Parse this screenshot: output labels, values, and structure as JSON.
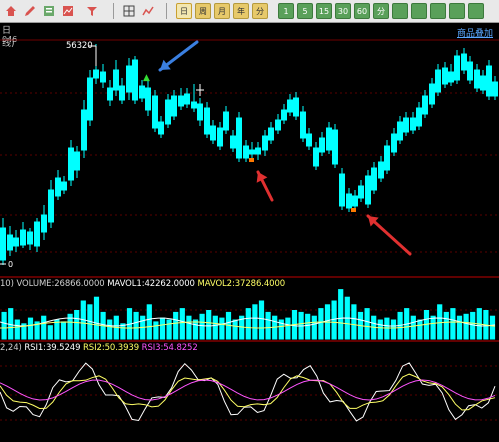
{
  "toolbar": {
    "icons": [
      "house-icon",
      "pen-icon",
      "notebook-icon",
      "chart-icon",
      "filter-icon",
      "grid-icon",
      "line-chart-icon"
    ],
    "period_buttons": [
      "日",
      "周",
      "月",
      "年",
      "1",
      "5",
      "15",
      "30",
      "60",
      "分",
      "分"
    ]
  },
  "info": {
    "left": "日线)",
    "left_prefix": "046",
    "right": "商品叠加"
  },
  "main_chart": {
    "high_label": "56320",
    "low_label": "0",
    "colors": {
      "up": "#ff3a3a",
      "down": "#00ffff",
      "grid": "#8b0000",
      "axis": "#d00000"
    }
  },
  "volume_panel": {
    "prefix": "10)",
    "volume": "VOLUME:26866.0000",
    "mavol1": "MAVOL1:42262.0000",
    "mavol2": "MAVOL2:37286.4000",
    "color_mavol1": "#ffffff",
    "color_mavol2": "#ffff66"
  },
  "rsi_panel": {
    "prefix": "2,24)",
    "rsi1": "RSI1:39.5249",
    "rsi2": "RSI2:50.3939",
    "rsi3": "RSI3:54.8252",
    "color_rsi1": "#ffffff",
    "color_rsi2": "#ffff66",
    "color_rsi3": "#ff55ff"
  }
}
